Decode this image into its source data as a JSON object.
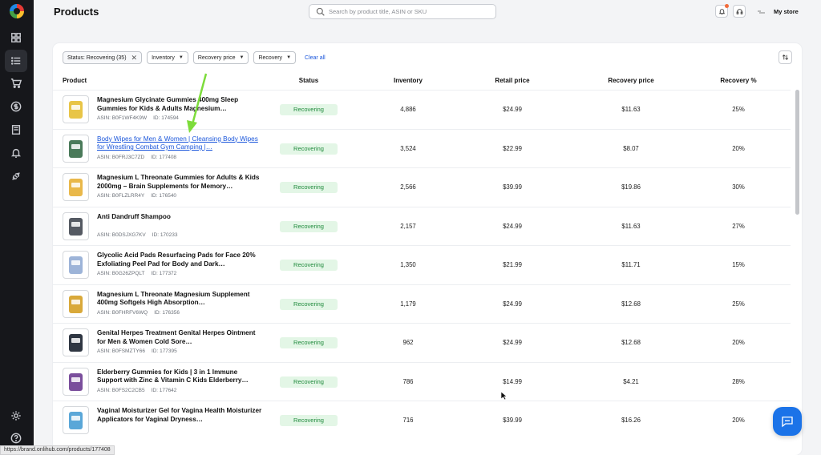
{
  "header": {
    "title": "Products",
    "search_placeholder": "Search by product title, ASIN or SKU",
    "store_name": "My store"
  },
  "sidebar": {
    "items": [
      {
        "icon": "dashboard-icon"
      },
      {
        "icon": "list-icon",
        "active": true
      },
      {
        "icon": "cart-icon"
      },
      {
        "icon": "dollar-icon"
      },
      {
        "icon": "book-icon"
      },
      {
        "icon": "bell-icon"
      },
      {
        "icon": "plug-icon"
      }
    ],
    "bottom": [
      {
        "icon": "gear-icon"
      },
      {
        "icon": "help-icon"
      }
    ]
  },
  "filters": {
    "status_chip": "Status: Recovering (35)",
    "inventory": "Inventory",
    "recovery_price": "Recovery price",
    "recovery": "Recovery",
    "clear_all": "Clear all"
  },
  "table": {
    "columns": {
      "product": "Product",
      "status": "Status",
      "inventory": "Inventory",
      "retail_price": "Retail price",
      "recovery_price": "Recovery price",
      "recovery_pct": "Recovery %"
    },
    "rows": [
      {
        "name": "Magnesium Glycinate Gummies 400mg Sleep Gummies for Kids & Adults Magnesium…",
        "asin": "ASIN: B0F1WF4K9W",
        "id": "ID: 174594",
        "status": "Recovering",
        "inventory": "4,886",
        "retail": "$24.99",
        "recovery_price": "$11.63",
        "recovery_pct": "25%",
        "color": "#e8c547",
        "link": false
      },
      {
        "name": "Body Wipes for Men & Women | Cleansing Body Wipes for Wrestling Combat Gym Camping |…",
        "asin": "ASIN: B0FRJ3C7ZD",
        "id": "ID: 177408",
        "status": "Recovering",
        "inventory": "3,524",
        "retail": "$22.99",
        "recovery_price": "$8.07",
        "recovery_pct": "20%",
        "color": "#4a7a5a",
        "link": true
      },
      {
        "name": "Magnesium L Threonate Gummies for Adults & Kids 2000mg – Brain Supplements for Memory…",
        "asin": "ASIN: B0FLZLRR4Y",
        "id": "ID: 176540",
        "status": "Recovering",
        "inventory": "2,566",
        "retail": "$39.99",
        "recovery_price": "$19.86",
        "recovery_pct": "30%",
        "color": "#e9b84a",
        "link": false
      },
      {
        "name": "Anti Dandruff Shampoo",
        "asin": "ASIN: B0DSJXG7KV",
        "id": "ID: 170233",
        "status": "Recovering",
        "inventory": "2,157",
        "retail": "$24.99",
        "recovery_price": "$11.63",
        "recovery_pct": "27%",
        "color": "#555a63",
        "link": false
      },
      {
        "name": "Glycolic Acid Pads Resurfacing Pads for Face 20% Exfoliating Peel Pad for Body and Dark…",
        "asin": "ASIN: B0G26ZPQLT",
        "id": "ID: 177372",
        "status": "Recovering",
        "inventory": "1,350",
        "retail": "$21.99",
        "recovery_price": "$11.71",
        "recovery_pct": "15%",
        "color": "#9db4d8",
        "link": false
      },
      {
        "name": "Magnesium L Threonate Magnesium Supplement 400mg Softgels High Absorption…",
        "asin": "ASIN: B0FHRFV6WQ",
        "id": "ID: 176356",
        "status": "Recovering",
        "inventory": "1,179",
        "retail": "$24.99",
        "recovery_price": "$12.68",
        "recovery_pct": "25%",
        "color": "#d9a93a",
        "link": false
      },
      {
        "name": "Genital Herpes Treatment Genital Herpes Ointment for Men & Women Cold Sore…",
        "asin": "ASIN: B0FSMZTY66",
        "id": "ID: 177395",
        "status": "Recovering",
        "inventory": "962",
        "retail": "$24.99",
        "recovery_price": "$12.68",
        "recovery_pct": "20%",
        "color": "#2f3642",
        "link": false
      },
      {
        "name": "Elderberry Gummies for Kids | 3 in 1 Immune Support with Zinc & Vitamin C Kids Elderberry…",
        "asin": "ASIN: B0FS2C2CB5",
        "id": "ID: 177642",
        "status": "Recovering",
        "inventory": "786",
        "retail": "$14.99",
        "recovery_price": "$4.21",
        "recovery_pct": "28%",
        "color": "#7a4e9c",
        "link": false
      },
      {
        "name": "Vaginal Moisturizer Gel for Vagina Health Moisturizer Applicators for Vaginal Dryness…",
        "asin": "",
        "id": "",
        "status": "Recovering",
        "inventory": "716",
        "retail": "$39.99",
        "recovery_price": "$16.26",
        "recovery_pct": "20%",
        "color": "#5aa7d8",
        "link": false
      }
    ]
  },
  "status_bar": "https://brand.onlihub.com/products/177408"
}
